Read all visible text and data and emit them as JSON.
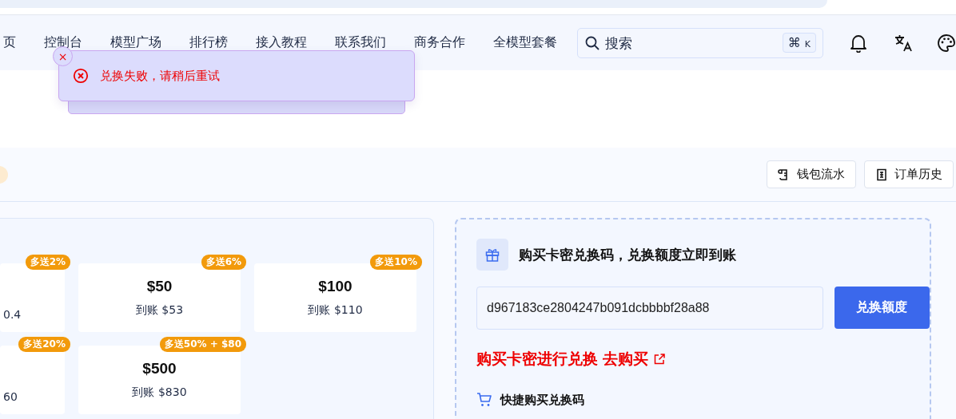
{
  "nav": {
    "items": [
      {
        "label": "页",
        "selected": false
      },
      {
        "label": "控制台",
        "selected": false
      },
      {
        "label": "模型广场",
        "selected": false
      },
      {
        "label": "排行榜",
        "selected": false
      },
      {
        "label": "接入教程",
        "selected": false
      },
      {
        "label": "联系我们",
        "selected": false
      },
      {
        "label": "商务合作",
        "selected": false
      },
      {
        "label": "全模型套餐",
        "selected": false
      }
    ],
    "search": {
      "placeholder": "搜索",
      "shortcut": [
        "⌘",
        "K"
      ]
    }
  },
  "toast": {
    "message": "兑换失败，请稍后重试",
    "close": "×"
  },
  "toolbar": {
    "buttons": [
      {
        "label": "钱包流水"
      },
      {
        "label": "订单历史"
      }
    ]
  },
  "packages": [
    {
      "badge": "多送2%",
      "arrival": "0.4"
    },
    {
      "badge": "多送6%",
      "amount": "$50",
      "arrival": "到账 $53"
    },
    {
      "badge": "多送10%",
      "amount": "$100",
      "arrival": "到账 $110"
    },
    {
      "badge": "多送20%",
      "arrival": "60"
    },
    {
      "badge": "多送50% + $80",
      "amount": "$500",
      "arrival": "到账 $830"
    }
  ],
  "redeem": {
    "title": "购买卡密兑换码，兑换额度立即到账",
    "code": "d967183ce2804247b091dcbbbbf28a88",
    "button": "兑换额度",
    "buy_text": "购买卡密进行兑换",
    "buy_link": "去购买",
    "quick_title": "快捷购买兑换码"
  }
}
